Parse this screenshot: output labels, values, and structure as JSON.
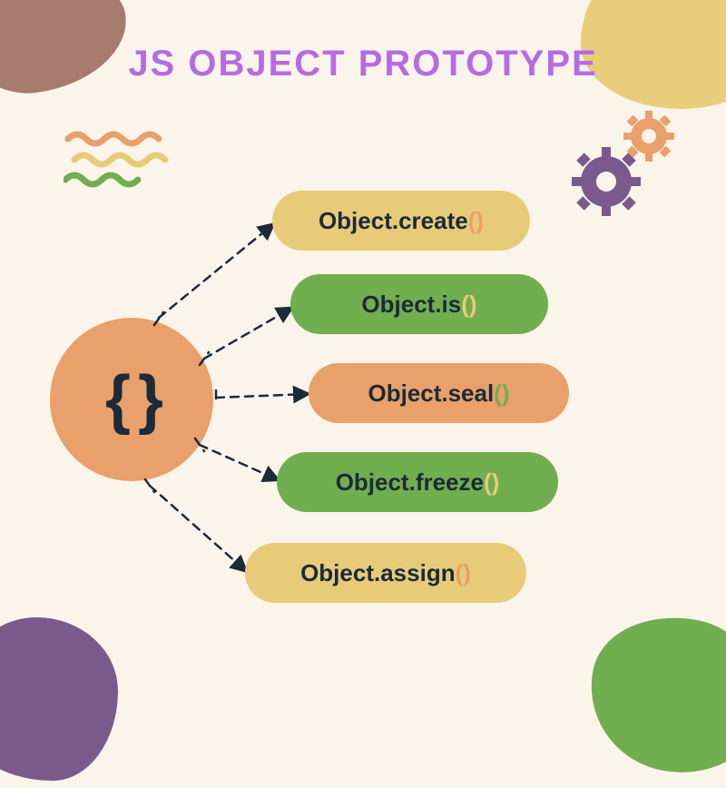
{
  "title": "JS OBJECT PROTOTYPE",
  "center_symbol": "{ }",
  "methods": [
    {
      "name": "Object.create",
      "parens": "()"
    },
    {
      "name": "Object.is",
      "parens": "()"
    },
    {
      "name": "Object.seal",
      "parens": "()"
    },
    {
      "name": "Object.freeze",
      "parens": "()"
    },
    {
      "name": "Object.assign",
      "parens": "()"
    }
  ],
  "colors": {
    "background": "#FBF4EB",
    "title": "#B56CE2",
    "yellow": "#E7CB79",
    "green": "#71AE50",
    "orange": "#E9A06A",
    "purple": "#7A5A8C",
    "brown": "#A67B6E",
    "dark": "#1C2A3A"
  }
}
